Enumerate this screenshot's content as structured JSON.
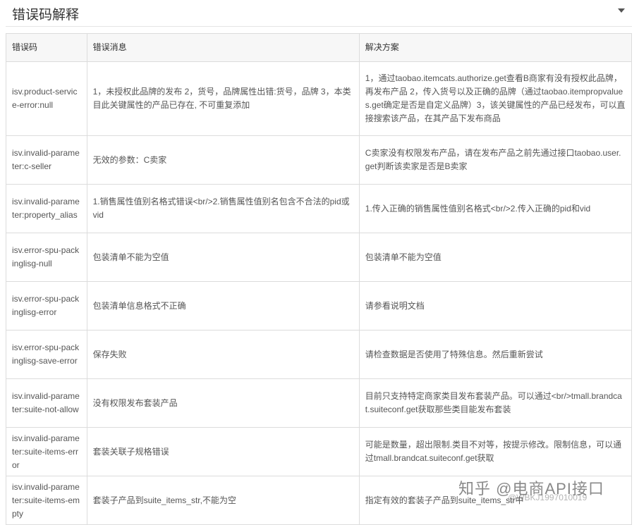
{
  "header": {
    "title": "错误码解释"
  },
  "table": {
    "columns": [
      "错误码",
      "错误消息",
      "解决方案"
    ],
    "rows": [
      {
        "code": "isv.product-service-error:null",
        "message": "1，未授权此品牌的发布 2，货号，品牌属性出错:货号，品牌 3，本类目此关键属性的产品已存在, 不可重复添加",
        "solution": "1，通过taobao.itemcats.authorize.get查看B商家有没有授权此品牌，再发布产品 2，传入货号以及正确的品牌（通过taobao.itempropvalues.get确定是否是自定义品牌）3，该关键属性的产品已经发布，可以直接搜索该产品，在其产品下发布商品"
      },
      {
        "code": "isv.invalid-parameter:c-seller",
        "message": "无效的参数：C卖家",
        "solution": "C卖家没有权限发布产品，请在发布产品之前先通过接口taobao.user.get判断该卖家是否是B卖家"
      },
      {
        "code": "isv.invalid-parameter:property_alias",
        "message": "1.销售属性值别名格式错误<br/>2.销售属性值别名包含不合法的pid或vid",
        "solution": "1.传入正确的销售属性值别名格式<br/>2.传入正确的pid和vid"
      },
      {
        "code": "isv.error-spu-packinglisg-null",
        "message": "包装清单不能为空值",
        "solution": "包装清单不能为空值"
      },
      {
        "code": "isv.error-spu-packinglisg-error",
        "message": "包装清单信息格式不正确",
        "solution": "请参看说明文档"
      },
      {
        "code": "isv.error-spu-packinglisg-save-error",
        "message": "保存失败",
        "solution": "请检查数据是否使用了特殊信息。然后重新尝试"
      },
      {
        "code": "isv.invalid-parameter:suite-not-allow",
        "message": "没有权限发布套装产品",
        "solution": "目前只支持特定商家类目发布套装产品。可以通过<br/>tmall.brandcat.suiteconf.get获取那些类目能发布套装"
      },
      {
        "code": "isv.invalid-parameter:suite-items-error",
        "message": "套装关联子规格错误",
        "solution": "可能是数量，超出限制.类目不对等，按提示修改。限制信息，可以通过tmall.brandcat.suiteconf.get获取"
      },
      {
        "code": "isv.invalid-parameter:suite-items-empty",
        "message": "套装子产品到suite_items_str,不能为空",
        "solution": "指定有效的套装子产品到suite_items_str中"
      }
    ]
  },
  "watermark": {
    "main": "知乎 @电商API接口",
    "sub": "@WBKJ1997010019"
  }
}
